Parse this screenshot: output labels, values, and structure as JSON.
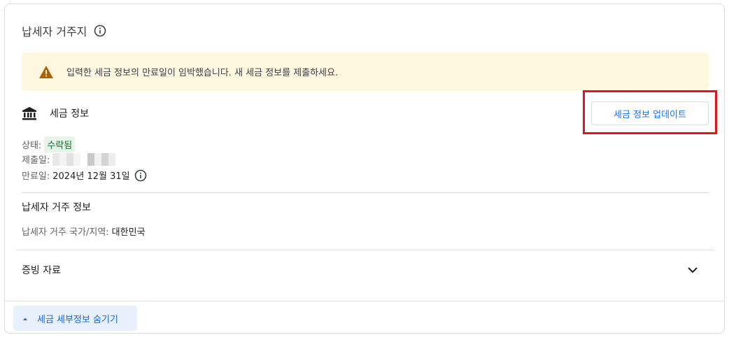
{
  "header": {
    "title": "납세자 거주지"
  },
  "warning": {
    "text": "입력한 세금 정보의 만료일이 임박했습니다. 새 세금 정보를 제출하세요."
  },
  "tax_info": {
    "label": "세금 정보",
    "update_button": "세금 정보 업데이트",
    "status_label": "상태:",
    "status_value": "수락됨",
    "submitted_label": "제출일:",
    "expiry_label": "만료일:",
    "expiry_value": "2024년 12월 31일"
  },
  "residence": {
    "title": "납세자 거주 정보",
    "country_label": "납세자 거주 국가/지역:",
    "country_value": "대한민국"
  },
  "evidence": {
    "title": "증빙 자료"
  },
  "footer": {
    "hide_details_button": "세금 세부정보 숨기기"
  },
  "colors": {
    "accent": "#1a73e8",
    "warning_bg": "#fef7e0",
    "highlight": "#e5141c",
    "success": "#137333"
  }
}
